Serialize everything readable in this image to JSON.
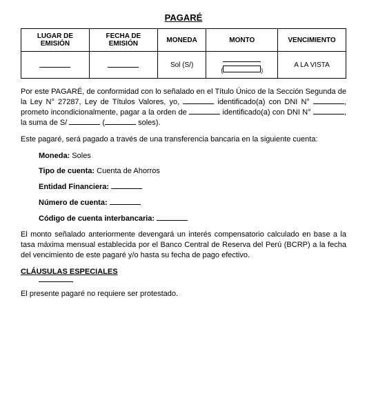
{
  "title": "PAGARÉ",
  "table": {
    "headers": {
      "lugar": "LUGAR DE EMISIÓN",
      "fecha": "FECHA DE EMISIÓN",
      "moneda": "MONEDA",
      "monto": "MONTO",
      "venc": "VENCIMIENTO"
    },
    "row": {
      "moneda_val": "Sol (S/)",
      "venc_val": "A LA VISTA"
    }
  },
  "body": {
    "p1a": "Por este PAGARÉ, de conformidad con lo señalado en el Título Único de la Sección Segunda de la Ley N° 27287, Ley de Títulos Valores, yo, ",
    "p1b": " identificado(a) con DNI N° ",
    "p1c": ", prometo incondicionalmente, pagar a la orden de ",
    "p1d": " identificado(a) con DNI N° ",
    "p1e": ", la suma de S/ ",
    "p1f": " (",
    "p1g": " soles).",
    "p2": "Este pagaré, será pagado a través de una transferencia bancaria en la siguiente cuenta:",
    "moneda_label": "Moneda:",
    "moneda_value": " Soles",
    "tipo_label": "Tipo de cuenta:",
    "tipo_value": " Cuenta de Ahorros",
    "entidad_label": "Entidad Financiera:",
    "numero_label": "Número de cuenta:",
    "cci_label": "Código de cuenta interbancaria:",
    "p3": "El monto señalado anteriormente devengará un interés compensatorio calculado en base a la tasa máxima mensual establecida por el Banco Central de Reserva del Perú (BCRP) a la fecha del vencimiento de este pagaré y/o hasta su fecha de pago efectivo.",
    "clauses_head": "CLÁUSULAS ESPECIALES",
    "p4": "El presente pagaré no requiere ser protestado."
  }
}
